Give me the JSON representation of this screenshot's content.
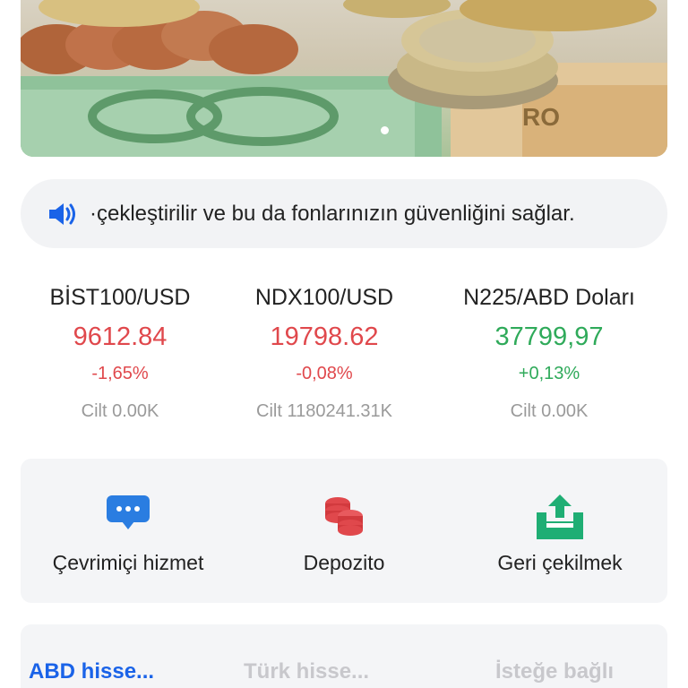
{
  "banner": {
    "image": "euro-coins-and-banknotes",
    "page_indicator": {
      "count": 1,
      "active": 0
    }
  },
  "announcement": {
    "icon": "speaker-icon",
    "text": "·çekleştirilir ve bu da fonlarınızın güvenliğini sağlar."
  },
  "indices": [
    {
      "name": "BİST100/USD",
      "value": "9612.84",
      "change": "-1,65%",
      "volume": "Cilt 0.00K",
      "trend": "down"
    },
    {
      "name": "NDX100/USD",
      "value": "19798.62",
      "change": "-0,08%",
      "volume": "Cilt 1180241.31K",
      "trend": "down"
    },
    {
      "name": "N225/ABD Doları",
      "value": "37799,97",
      "change": "+0,13%",
      "volume": "Cilt 0.00K",
      "trend": "up"
    }
  ],
  "actions": [
    {
      "label": "Çevrimiçi hizmet",
      "icon": "chat-bubble-icon"
    },
    {
      "label": "Depozito",
      "icon": "coins-stack-icon"
    },
    {
      "label": "Geri çekilmek",
      "icon": "upload-tray-icon"
    }
  ],
  "tabs": [
    {
      "label": "ABD hisse...",
      "active": true
    },
    {
      "label": "Türk hisse...",
      "active": false
    },
    {
      "label": "İsteğe bağlı",
      "active": false
    }
  ],
  "colors": {
    "accent": "#1a63e8",
    "down": "#e0484c",
    "up": "#2faa5a",
    "muted": "#9a9a9a"
  }
}
